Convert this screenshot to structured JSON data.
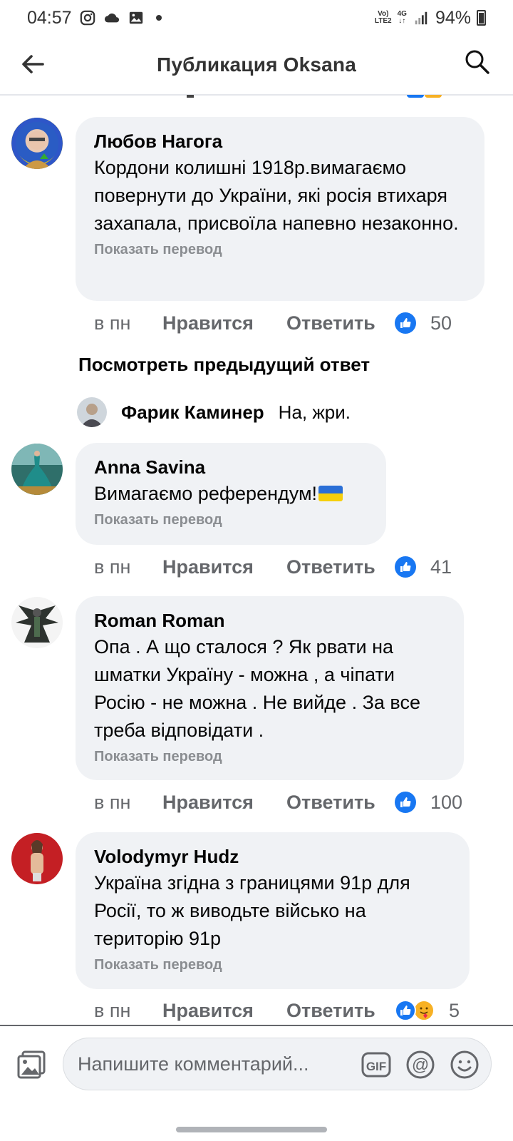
{
  "status_bar": {
    "time": "04:57",
    "network_top": "Vo)",
    "network_bottom": "LTE2",
    "signal_type": "4G",
    "battery_percent": "94%",
    "icons": [
      "instagram-icon",
      "cloud-icon",
      "gallery-icon"
    ]
  },
  "header": {
    "title": "Публикация Oksana",
    "back_icon": "back-arrow-icon",
    "search_icon": "search-icon"
  },
  "comments": [
    {
      "author": "Любов Нагога",
      "text": "Кордони колишні 1918р.вимагаємо повернути до України,  які росія втихаря захапала, присвоїла напевно незаконно.",
      "translate": "Показать перевод",
      "time": "в пн",
      "like": "Нравится",
      "reply": "Ответить",
      "reaction_count": "50",
      "reactions": [
        "like"
      ]
    },
    {
      "author": "Anna Savina",
      "text": "Вимагаємо референдум!",
      "translate": "Показать перевод",
      "time": "в пн",
      "like": "Нравится",
      "reply": "Ответить",
      "reaction_count": "41",
      "reactions": [
        "like"
      ]
    },
    {
      "author": "Roman Roman",
      "text": "Опа . А що сталося ? Як рвати на шматки Україну - можна , а чіпати Росію - не можна . Не вийде . За все треба відповідати .",
      "translate": "Показать перевод",
      "time": "в пн",
      "like": "Нравится",
      "reply": "Ответить",
      "reaction_count": "100",
      "reactions": [
        "like"
      ]
    },
    {
      "author": "Volodymyr Hudz",
      "text": "Україна згідна з границями 91р для Росії, то ж виводьте військо на територію 91р",
      "translate": "Показать перевод",
      "time": "в пн",
      "like": "Нравится",
      "reply": "Ответить",
      "reaction_count": "5",
      "reactions": [
        "like",
        "care"
      ]
    }
  ],
  "previous_replies_label": "Посмотреть предыдущий ответ",
  "reply_preview": {
    "author": "Фарик Каминер",
    "text": "На, жри."
  },
  "composer": {
    "placeholder": "Напишите комментарий...",
    "gif_label": "GIF"
  },
  "colors": {
    "bubble": "#f0f2f5",
    "like_blue": "#1877f2",
    "muted": "#65676b"
  }
}
